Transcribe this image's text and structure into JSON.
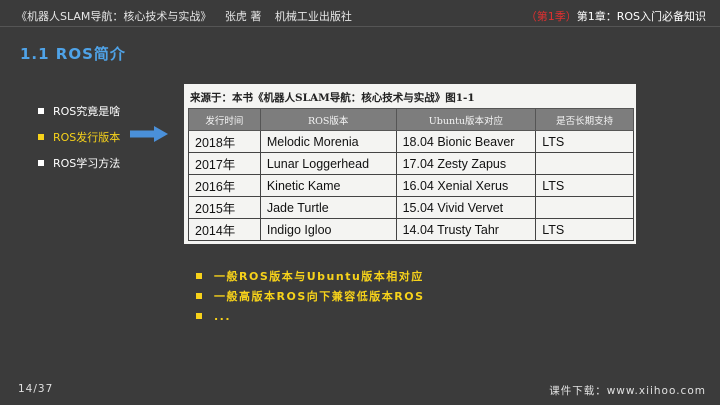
{
  "header": {
    "book_title": "《机器人SLAM导航：核心技术与实战》",
    "author": "张虎 著",
    "publisher": "机械工业出版社",
    "chapter_num": "（第1季）",
    "chapter_title": "第1章：ROS入门必备知识"
  },
  "slide": {
    "title": "1.1 ROS简介"
  },
  "nav": {
    "items": [
      {
        "label": "ROS究竟是啥",
        "active": false
      },
      {
        "label": "ROS发行版本",
        "active": true
      },
      {
        "label": "ROS学习方法",
        "active": false
      }
    ]
  },
  "figure": {
    "caption": "来源于：本书《机器人SLAM导航：核心技术与实战》图1-1",
    "headers": [
      "发行时间",
      "ROS版本",
      "Ubuntu版本对应",
      "是否长期支持"
    ],
    "rows": [
      [
        "2018年",
        "Melodic Morenia",
        "18.04 Bionic Beaver",
        "LTS"
      ],
      [
        "2017年",
        "Lunar Loggerhead",
        "17.04 Zesty Zapus",
        ""
      ],
      [
        "2016年",
        "Kinetic Kame",
        "16.04 Xenial Xerus",
        "LTS"
      ],
      [
        "2015年",
        "Jade Turtle",
        "15.04 Vivid Vervet",
        ""
      ],
      [
        "2014年",
        "Indigo Igloo",
        "14.04 Trusty Tahr",
        "LTS"
      ]
    ]
  },
  "notes": [
    "一般ROS版本与Ubuntu版本相对应",
    "一般高版本ROS向下兼容低版本ROS",
    "..."
  ],
  "footer": {
    "page": "14/37",
    "download": "课件下载：www.xiihoo.com"
  },
  "colors": {
    "accent_blue": "#4fa3e8",
    "highlight_yellow": "#f7d21a",
    "chapter_red": "#e03030",
    "background": "#3b3b3b"
  }
}
